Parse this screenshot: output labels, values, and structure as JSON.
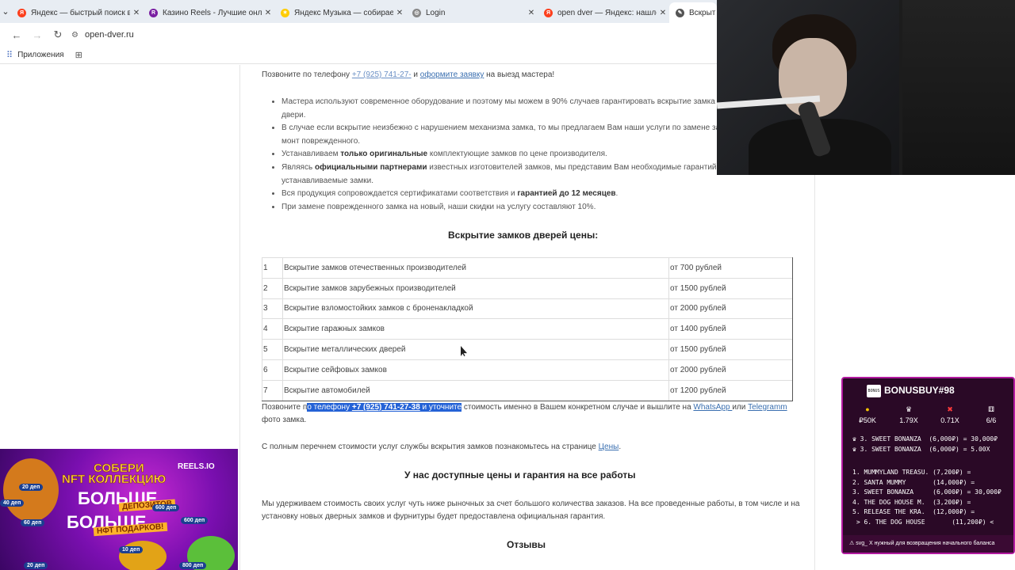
{
  "browser": {
    "tabs": [
      {
        "title": "Яндекс — быстрый поиск в ин",
        "icon": "yandex-icon",
        "color": "#fc3f1d",
        "glyph": "Я"
      },
      {
        "title": "Казино Reels - Лучшие онлай",
        "icon": "reels-icon",
        "color": "#7a1fa2",
        "glyph": "R"
      },
      {
        "title": "Яндекс Музыка — собираем м",
        "icon": "yandex-music-icon",
        "color": "#ffcc00",
        "glyph": "✶"
      },
      {
        "title": "Login",
        "icon": "globe-icon",
        "color": "#888888",
        "glyph": "◎"
      },
      {
        "title": "open dver — Яндекс: нашлос",
        "icon": "yandex-icon",
        "color": "#fc3f1d",
        "glyph": "Я"
      },
      {
        "title": "Вскрыт",
        "icon": "wrench-icon",
        "color": "#555555",
        "glyph": "✎"
      }
    ],
    "address": "open-dver.ru",
    "bookmarks_label": "Приложения"
  },
  "page": {
    "intro": {
      "before": "Позвоните по телефону ",
      "phone": "+7 (925) 741-27-",
      "middle": " и ",
      "order_link": "оформите заявку",
      "after": " на выезд мастера!"
    },
    "bullets": [
      {
        "pre": "Мастера используют современное оборудование и поэтому мы можем в 90% случаев гарантировать вскрытие замка без",
        "bold": "",
        "post": "",
        "line2": "двери."
      },
      {
        "pre": "В случае если вскрытие неизбежно с нарушением механизма замка, то мы предлагаем Вам наши услуги по замене зам",
        "bold": "",
        "post": "",
        "line2": "монт поврежденного."
      },
      {
        "pre": "Устанавливаем ",
        "bold": "только оригинальные",
        "post": " комплектующие замков по цене производителя.",
        "line2": ""
      },
      {
        "pre": "Являясь ",
        "bold": "официальными партнерами",
        "post": " известных изготовителей замков, мы представим Вам необходимые гарантийн",
        "line2": "устанавливаемые замки."
      },
      {
        "pre": "Вся продукция сопровождается сертификатами соответствия и ",
        "bold": "гарантией до 12 месяцев",
        "post": ".",
        "line2": ""
      },
      {
        "pre": "При замене поврежденного замка на новый, наши скидки на услугу составляют 10%.",
        "bold": "",
        "post": "",
        "line2": ""
      }
    ],
    "prices_heading": "Вскрытие замков дверей цены:",
    "price_rows": [
      {
        "num": "1",
        "name": "Вскрытие замков отечественных производителей",
        "price": "от 700 рублей"
      },
      {
        "num": "2",
        "name": "Вскрытие замков зарубежных производителей",
        "price": "от 1500 рублей"
      },
      {
        "num": "3",
        "name": "Вскрытие взломостойких замков с броненакладкой",
        "price": "от 2000 рублей"
      },
      {
        "num": "4",
        "name": "Вскрытие гаражных замков",
        "price": "от 1400 рублей"
      },
      {
        "num": "5",
        "name": "Вскрытие металлических дверей",
        "price": "от 1500 рублей"
      },
      {
        "num": "6",
        "name": "Вскрытие сейфовых замков",
        "price": "от 2000 рублей"
      },
      {
        "num": "7",
        "name": "Вскрытие автомобилей",
        "price": "от 1200 рублей"
      }
    ],
    "call_line": {
      "before": "Позвоните  п",
      "selected_pre": "о телефону ",
      "phone": "+7 (925) 741-27-38",
      "selected_post": "  и уточните",
      "after": " стоимость именно в Вашем конкретном случае и вышлите на ",
      "whatsapp": "WhatsApp ",
      "or": "или ",
      "telegram": "Telegramm",
      "line2": "фото замка."
    },
    "full_list": {
      "before": "С полным перечнем стоимости услуг службы вскрытия замков познакомьтесь на странице ",
      "link": "Цены",
      "after": "."
    },
    "guarantee_heading": "У нас доступные цены и гарантия на все работы",
    "guarantee_text_1": "Мы удерживаем стоимость своих услуг чуть ниже рыночных за счет большого количества заказов. На все проведенные работы, в том числе и на",
    "guarantee_text_2": "установку новых дверных замков и фурнитуры будет предоставлена официальная гарантия.",
    "reviews_heading": "Отзывы"
  },
  "ad": {
    "line1": "СОБЕРИ",
    "line2": "NFT КОЛЛЕКЦИЮ",
    "line3": "БОЛЬШЕ",
    "badge1": "ДЕПОЗИТОВ",
    "line5": "БОЛЬШЕ",
    "badge2": "НФТ ПОДАРКОВ!",
    "logo": "REELS.IO",
    "chips": [
      "20 деп",
      "40 деп",
      "60 деп",
      "600 деп",
      "600 деп",
      "10 деп",
      "20 деп",
      "800 деп"
    ]
  },
  "bonus": {
    "title": "BONUSBUY#98",
    "icon_label": "BONUS",
    "stats": [
      {
        "icon": "coin-icon",
        "value": "₽50K"
      },
      {
        "icon": "multiplier-icon",
        "value": "1.79X"
      },
      {
        "icon": "cross-icon",
        "value": "0.71X"
      },
      {
        "icon": "dice-icon",
        "value": "6/6"
      }
    ],
    "best": "♛ 3. SWEET BONANZA  (6,000₽) = 30,000₽\n♛ 3. SWEET BONANZA  (6,000₽) = 5.00X",
    "list": "1. MUMMYLAND TREASU. (7,200₽) =\n2. SANTA MUMMY       (14,000₽) =\n3. SWEET BONANZA     (6,000₽) = 30,000₽\n4. THE DOG HOUSE M.  (3,200₽) =\n5. RELEASE THE KRA.  (12,000₽) =\n > 6. THE DOG HOUSE       (11,200₽) <",
    "footer": "⚠ svg_ Х нужный для возвращения начального баланса"
  }
}
